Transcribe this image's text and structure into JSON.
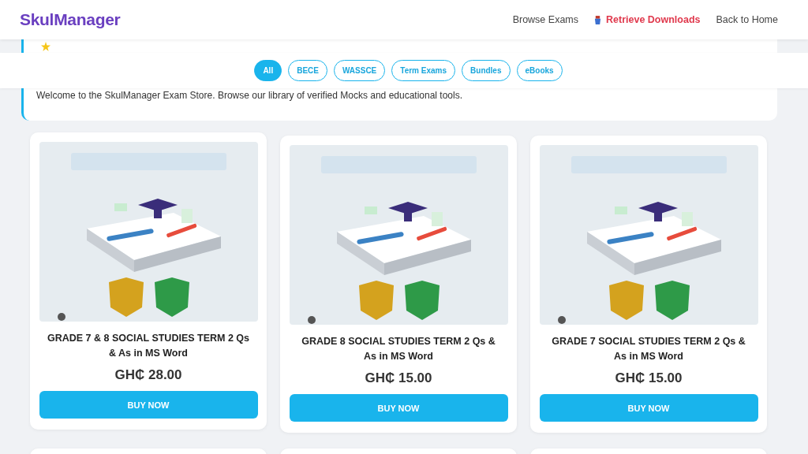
{
  "header": {
    "logo": "SkulManager",
    "nav": [
      {
        "label": "Browse Exams",
        "kind": "plain"
      },
      {
        "label": "Retrieve Downloads",
        "kind": "highlight"
      },
      {
        "label": "Back to Home",
        "kind": "plain"
      }
    ]
  },
  "filters": [
    {
      "label": "All",
      "selected": true
    },
    {
      "label": "BECE",
      "selected": false
    },
    {
      "label": "WASSCE",
      "selected": false
    },
    {
      "label": "Term Exams",
      "selected": false
    },
    {
      "label": "Bundles",
      "selected": false
    },
    {
      "label": "eBooks",
      "selected": false
    }
  ],
  "hero": {
    "text": "Welcome to the SkulManager Exam Store. Browse our library of verified Mocks and educational tools."
  },
  "products": [
    {
      "title": "GRADE 7 & 8 SOCIAL STUDIES TERM 2 Qs & As in MS Word",
      "price": "GH₵ 28.00",
      "button": "BUY NOW"
    },
    {
      "title": "GRADE 8 SOCIAL STUDIES TERM 2 Qs & As in MS Word",
      "price": "GH₵ 15.00",
      "button": "BUY NOW"
    },
    {
      "title": "GRADE 7 SOCIAL STUDIES TERM 2 Qs & As in MS Word",
      "price": "GH₵ 15.00",
      "button": "BUY NOW"
    }
  ]
}
